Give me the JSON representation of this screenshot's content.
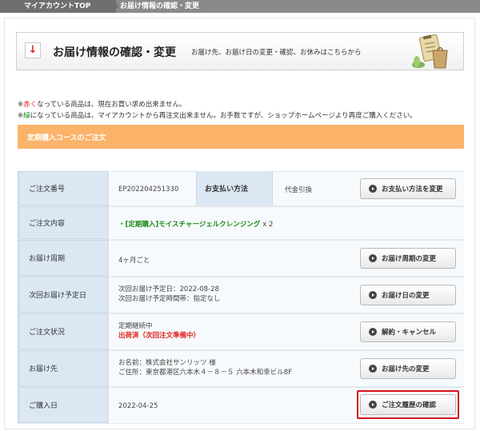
{
  "breadcrumb": {
    "top": "マイアカウントTOP",
    "current": "お届け情報の確認・変更"
  },
  "header": {
    "icon": "down-arrow-icon",
    "title": "お届け情報の確認・変更",
    "subtitle": "お届け先、お届け日の変更・確認、お休みはこちらから",
    "illustration": "clipboard-shopping-bag-illustration"
  },
  "notes": {
    "line1_prefix": "※",
    "line1_color": "赤く",
    "line1_rest": "なっている商品は、現在お買い求め出来ません。",
    "line2_prefix": "※",
    "line2_color": "緑",
    "line2_rest": "になっている商品は、マイアカウントから再注文出来ません。お手数ですが、ショップホームページより再度ご購入ください。"
  },
  "banner": {
    "label": "定期購入コースのご注文"
  },
  "rows": {
    "order_number": {
      "label": "ご注文番号",
      "value": "EP202204251330",
      "pay_label": "お支払い方法",
      "pay_value": "代金引換",
      "button": "お支払い方法を変更"
    },
    "order_content": {
      "label": "ご注文内容",
      "value": "・[定期購入]モイスチャージェルクレンジング",
      "qty": "x 2"
    },
    "delivery_cycle": {
      "label": "お届け周期",
      "value": "4ヶ月ごと",
      "button": "お届け周期の変更"
    },
    "next_delivery": {
      "label": "次回お届け予定日",
      "line1": "次回お届け予定日：2022-08-28",
      "line2": "次回お届け予定時間帯：指定なし",
      "button": "お届け日の変更"
    },
    "order_status": {
      "label": "ご注文状況",
      "line1": "定期継続中",
      "line2": "出荷済（次回注文準備中）",
      "button": "解約・キャンセル"
    },
    "delivery_address": {
      "label": "お届け先",
      "line1": "お名前：株式会社サンリッツ 様",
      "line2": "ご住所：東京都港区六本木４－８－５ 六本木和幸ビル8F",
      "button": "お届け先の変更"
    },
    "purchase_date": {
      "label": "ご購入日",
      "value": "2022-04-25",
      "button": "ご注文履歴の確認"
    }
  },
  "colors": {
    "accent_red": "#e0211d",
    "green": "#1a8a1a",
    "banner_orange": "#fbb36a",
    "label_bg": "#dbe8f4",
    "highlight_red": "#d8131b"
  }
}
